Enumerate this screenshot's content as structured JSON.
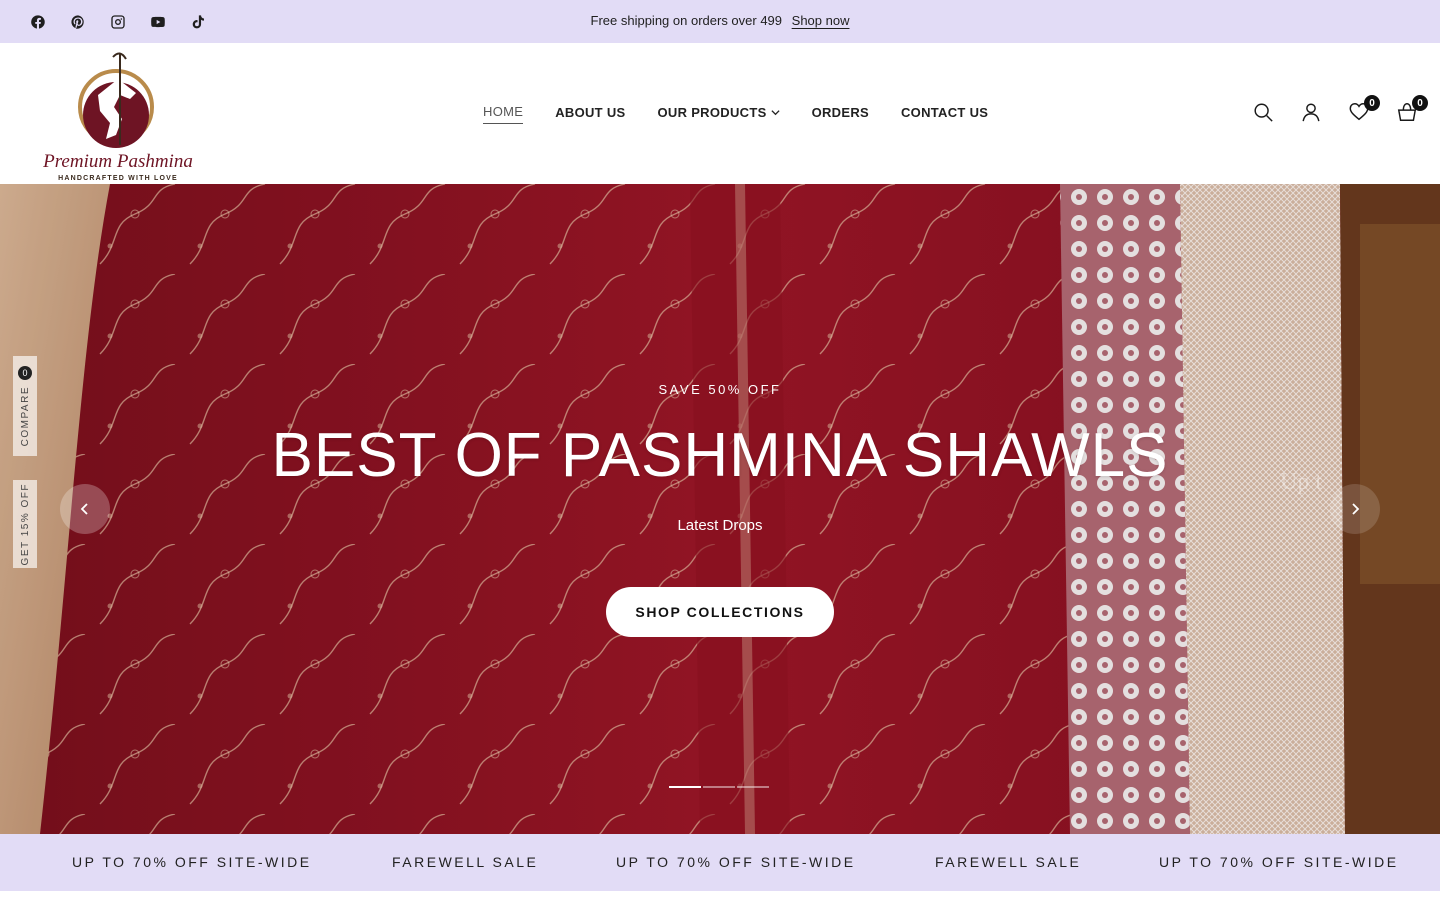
{
  "announcement": {
    "text": "Free shipping on orders over 499",
    "link": "Shop now"
  },
  "socials": [
    "facebook-icon",
    "pinterest-icon",
    "instagram-icon",
    "youtube-icon",
    "tiktok-icon"
  ],
  "logo": {
    "brand": "Premium Pashmina",
    "tagline": "HANDCRAFTED WITH LOVE"
  },
  "nav": {
    "home": "HOME",
    "about": "ABOUT US",
    "products": "OUR PRODUCTS",
    "orders": "ORDERS",
    "contact": "CONTACT US"
  },
  "header_icons": {
    "search": "search-icon",
    "account": "user-icon",
    "wishlist": "heart-icon",
    "wishlist_count": "0",
    "cart": "cart-icon",
    "cart_count": "0"
  },
  "hero": {
    "eyebrow": "SAVE 50% OFF",
    "headline": "BEST OF PASHMINA SHAWLS",
    "subline": "Latest Drops",
    "cta": "SHOP COLLECTIONS",
    "ghost_text": "Up t",
    "slides": 3,
    "active_slide": 1
  },
  "side_tabs": {
    "compare": "COMPARE",
    "compare_count": "0",
    "discount": "GET 15% OFF"
  },
  "marquee": [
    "UP TO 70% OFF SITE-WIDE",
    "FAREWELL SALE",
    "UP TO 70% OFF SITE-WIDE",
    "FAREWELL SALE",
    "UP TO 70% OFF SITE-WIDE"
  ],
  "colors": {
    "announcement_bg": "#e2dcf6",
    "hero_red": "#8c1322",
    "logo_maroon": "#6e1424",
    "logo_gold": "#b98b4b"
  }
}
